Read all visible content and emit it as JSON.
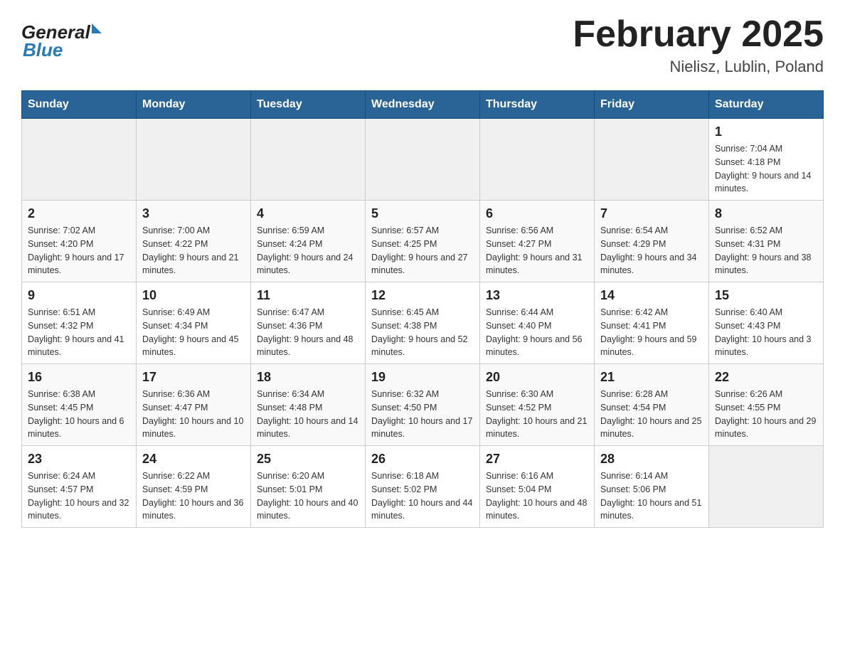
{
  "header": {
    "logo": {
      "general": "General",
      "blue": "Blue"
    },
    "title": "February 2025",
    "location": "Nielisz, Lublin, Poland"
  },
  "weekdays": [
    "Sunday",
    "Monday",
    "Tuesday",
    "Wednesday",
    "Thursday",
    "Friday",
    "Saturday"
  ],
  "weeks": [
    [
      {
        "day": "",
        "sunrise": "",
        "sunset": "",
        "daylight": ""
      },
      {
        "day": "",
        "sunrise": "",
        "sunset": "",
        "daylight": ""
      },
      {
        "day": "",
        "sunrise": "",
        "sunset": "",
        "daylight": ""
      },
      {
        "day": "",
        "sunrise": "",
        "sunset": "",
        "daylight": ""
      },
      {
        "day": "",
        "sunrise": "",
        "sunset": "",
        "daylight": ""
      },
      {
        "day": "",
        "sunrise": "",
        "sunset": "",
        "daylight": ""
      },
      {
        "day": "1",
        "sunrise": "Sunrise: 7:04 AM",
        "sunset": "Sunset: 4:18 PM",
        "daylight": "Daylight: 9 hours and 14 minutes."
      }
    ],
    [
      {
        "day": "2",
        "sunrise": "Sunrise: 7:02 AM",
        "sunset": "Sunset: 4:20 PM",
        "daylight": "Daylight: 9 hours and 17 minutes."
      },
      {
        "day": "3",
        "sunrise": "Sunrise: 7:00 AM",
        "sunset": "Sunset: 4:22 PM",
        "daylight": "Daylight: 9 hours and 21 minutes."
      },
      {
        "day": "4",
        "sunrise": "Sunrise: 6:59 AM",
        "sunset": "Sunset: 4:24 PM",
        "daylight": "Daylight: 9 hours and 24 minutes."
      },
      {
        "day": "5",
        "sunrise": "Sunrise: 6:57 AM",
        "sunset": "Sunset: 4:25 PM",
        "daylight": "Daylight: 9 hours and 27 minutes."
      },
      {
        "day": "6",
        "sunrise": "Sunrise: 6:56 AM",
        "sunset": "Sunset: 4:27 PM",
        "daylight": "Daylight: 9 hours and 31 minutes."
      },
      {
        "day": "7",
        "sunrise": "Sunrise: 6:54 AM",
        "sunset": "Sunset: 4:29 PM",
        "daylight": "Daylight: 9 hours and 34 minutes."
      },
      {
        "day": "8",
        "sunrise": "Sunrise: 6:52 AM",
        "sunset": "Sunset: 4:31 PM",
        "daylight": "Daylight: 9 hours and 38 minutes."
      }
    ],
    [
      {
        "day": "9",
        "sunrise": "Sunrise: 6:51 AM",
        "sunset": "Sunset: 4:32 PM",
        "daylight": "Daylight: 9 hours and 41 minutes."
      },
      {
        "day": "10",
        "sunrise": "Sunrise: 6:49 AM",
        "sunset": "Sunset: 4:34 PM",
        "daylight": "Daylight: 9 hours and 45 minutes."
      },
      {
        "day": "11",
        "sunrise": "Sunrise: 6:47 AM",
        "sunset": "Sunset: 4:36 PM",
        "daylight": "Daylight: 9 hours and 48 minutes."
      },
      {
        "day": "12",
        "sunrise": "Sunrise: 6:45 AM",
        "sunset": "Sunset: 4:38 PM",
        "daylight": "Daylight: 9 hours and 52 minutes."
      },
      {
        "day": "13",
        "sunrise": "Sunrise: 6:44 AM",
        "sunset": "Sunset: 4:40 PM",
        "daylight": "Daylight: 9 hours and 56 minutes."
      },
      {
        "day": "14",
        "sunrise": "Sunrise: 6:42 AM",
        "sunset": "Sunset: 4:41 PM",
        "daylight": "Daylight: 9 hours and 59 minutes."
      },
      {
        "day": "15",
        "sunrise": "Sunrise: 6:40 AM",
        "sunset": "Sunset: 4:43 PM",
        "daylight": "Daylight: 10 hours and 3 minutes."
      }
    ],
    [
      {
        "day": "16",
        "sunrise": "Sunrise: 6:38 AM",
        "sunset": "Sunset: 4:45 PM",
        "daylight": "Daylight: 10 hours and 6 minutes."
      },
      {
        "day": "17",
        "sunrise": "Sunrise: 6:36 AM",
        "sunset": "Sunset: 4:47 PM",
        "daylight": "Daylight: 10 hours and 10 minutes."
      },
      {
        "day": "18",
        "sunrise": "Sunrise: 6:34 AM",
        "sunset": "Sunset: 4:48 PM",
        "daylight": "Daylight: 10 hours and 14 minutes."
      },
      {
        "day": "19",
        "sunrise": "Sunrise: 6:32 AM",
        "sunset": "Sunset: 4:50 PM",
        "daylight": "Daylight: 10 hours and 17 minutes."
      },
      {
        "day": "20",
        "sunrise": "Sunrise: 6:30 AM",
        "sunset": "Sunset: 4:52 PM",
        "daylight": "Daylight: 10 hours and 21 minutes."
      },
      {
        "day": "21",
        "sunrise": "Sunrise: 6:28 AM",
        "sunset": "Sunset: 4:54 PM",
        "daylight": "Daylight: 10 hours and 25 minutes."
      },
      {
        "day": "22",
        "sunrise": "Sunrise: 6:26 AM",
        "sunset": "Sunset: 4:55 PM",
        "daylight": "Daylight: 10 hours and 29 minutes."
      }
    ],
    [
      {
        "day": "23",
        "sunrise": "Sunrise: 6:24 AM",
        "sunset": "Sunset: 4:57 PM",
        "daylight": "Daylight: 10 hours and 32 minutes."
      },
      {
        "day": "24",
        "sunrise": "Sunrise: 6:22 AM",
        "sunset": "Sunset: 4:59 PM",
        "daylight": "Daylight: 10 hours and 36 minutes."
      },
      {
        "day": "25",
        "sunrise": "Sunrise: 6:20 AM",
        "sunset": "Sunset: 5:01 PM",
        "daylight": "Daylight: 10 hours and 40 minutes."
      },
      {
        "day": "26",
        "sunrise": "Sunrise: 6:18 AM",
        "sunset": "Sunset: 5:02 PM",
        "daylight": "Daylight: 10 hours and 44 minutes."
      },
      {
        "day": "27",
        "sunrise": "Sunrise: 6:16 AM",
        "sunset": "Sunset: 5:04 PM",
        "daylight": "Daylight: 10 hours and 48 minutes."
      },
      {
        "day": "28",
        "sunrise": "Sunrise: 6:14 AM",
        "sunset": "Sunset: 5:06 PM",
        "daylight": "Daylight: 10 hours and 51 minutes."
      },
      {
        "day": "",
        "sunrise": "",
        "sunset": "",
        "daylight": ""
      }
    ]
  ]
}
